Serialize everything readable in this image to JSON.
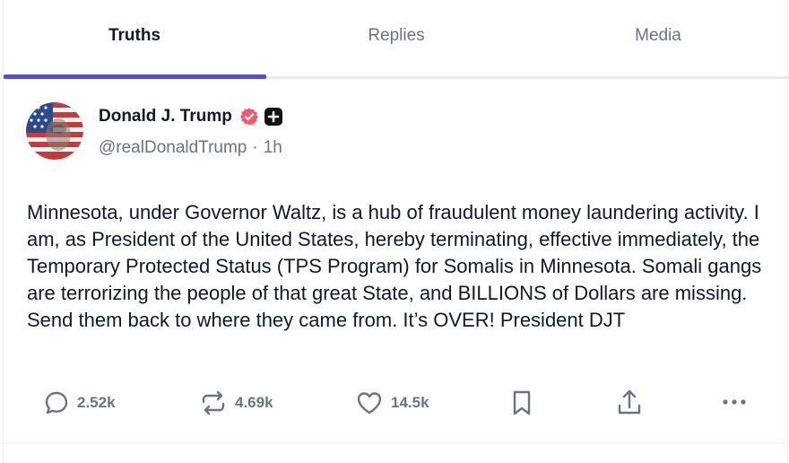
{
  "tabs": [
    {
      "label": "Truths",
      "active": true
    },
    {
      "label": "Replies",
      "active": false
    },
    {
      "label": "Media",
      "active": false
    }
  ],
  "post": {
    "author": {
      "display_name": "Donald J. Trump",
      "handle": "@realDonaldTrump",
      "verified_icon": "verified-badge-icon",
      "plus_icon": "plus-badge-icon"
    },
    "separator": "·",
    "time_ago": "1h",
    "text": "Minnesota, under Governor Waltz, is a hub of fraudulent money laundering activity. I am, as President of the United States, hereby terminating, effective immediately, the Temporary Protected Status (TPS Program) for Somalis in Minnesota. Somali gangs are terrorizing the people of that great State, and BILLIONS of Dollars are missing. Send them back to where they came from. It’s OVER! President DJT",
    "actions": {
      "reply_count": "2.52k",
      "retruth_count": "4.69k",
      "like_count": "14.5k"
    }
  },
  "colors": {
    "accent": "#5448ee",
    "verified": "#ef5a6f",
    "muted": "#6b7280",
    "text": "#111827"
  }
}
